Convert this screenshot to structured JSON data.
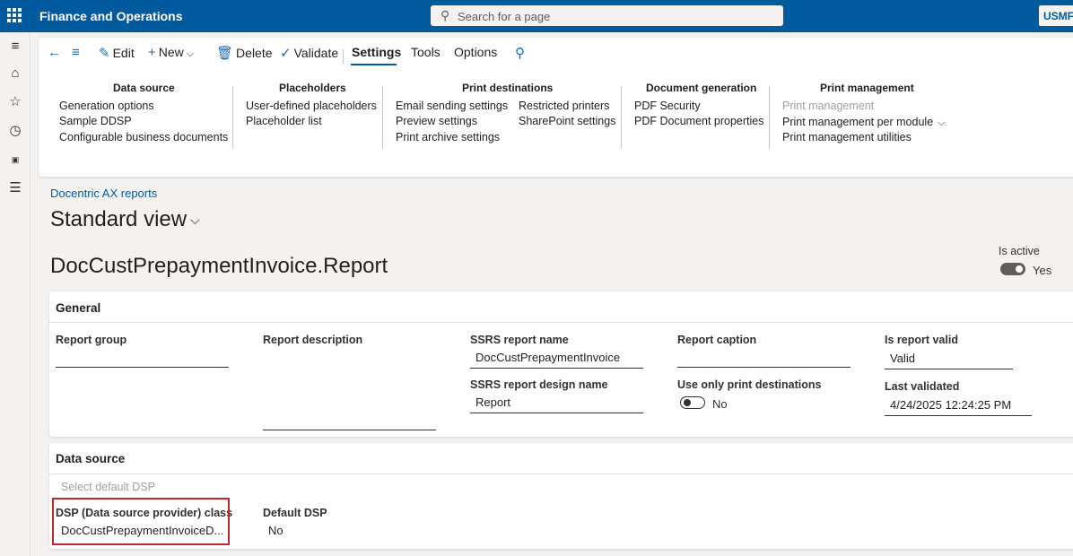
{
  "app": {
    "title": "Finance and Operations",
    "company": "USMF"
  },
  "search": {
    "placeholder": "Search for a page"
  },
  "toolbar": {
    "edit": "Edit",
    "new": "New",
    "delete": "Delete",
    "validate": "Validate",
    "tabs": [
      "Settings",
      "Tools",
      "Options"
    ]
  },
  "ribbon": {
    "data_source": {
      "title": "Data source",
      "items": [
        "Generation options",
        "Sample DDSP",
        "Configurable business documents"
      ]
    },
    "placeholders": {
      "title": "Placeholders",
      "items": [
        "User-defined placeholders",
        "Placeholder list"
      ]
    },
    "print_destinations": {
      "title": "Print destinations",
      "col1": [
        "Email sending settings",
        "Preview settings",
        "Print archive settings"
      ],
      "col2": [
        "Restricted printers",
        "SharePoint settings"
      ]
    },
    "document_generation": {
      "title": "Document generation",
      "items": [
        "PDF Security",
        "PDF Document properties"
      ]
    },
    "print_management": {
      "title": "Print management",
      "items": [
        "Print management",
        "Print management per module",
        "Print management utilities"
      ]
    }
  },
  "page": {
    "breadcrumb": "Docentric AX reports",
    "view": "Standard view",
    "record_title": "DocCustPrepaymentInvoice.Report",
    "is_active_label": "Is active",
    "is_active_value": "Yes"
  },
  "general": {
    "header": "General",
    "report_group_label": "Report group",
    "report_group_value": "",
    "report_description_label": "Report description",
    "report_description_value": "",
    "ssrs_report_name_label": "SSRS report name",
    "ssrs_report_name_value": "DocCustPrepaymentInvoice",
    "ssrs_design_label": "SSRS report design name",
    "ssrs_design_value": "Report",
    "report_caption_label": "Report caption",
    "report_caption_value": "",
    "use_only_print_label": "Use only print destinations",
    "use_only_print_value": "No",
    "is_report_valid_label": "Is report valid",
    "is_report_valid_value": "Valid",
    "last_validated_label": "Last validated",
    "last_validated_value": "4/24/2025 12:24:25 PM"
  },
  "datasource": {
    "header": "Data source",
    "select_default": "Select default DSP",
    "dsp_class_label": "DSP (Data source provider) class",
    "dsp_class_value": "DocCustPrepaymentInvoiceD...",
    "default_dsp_label": "Default DSP",
    "default_dsp_value": "No"
  },
  "colors": {
    "brand": "#005a9e",
    "highlight": "#c4262e"
  }
}
